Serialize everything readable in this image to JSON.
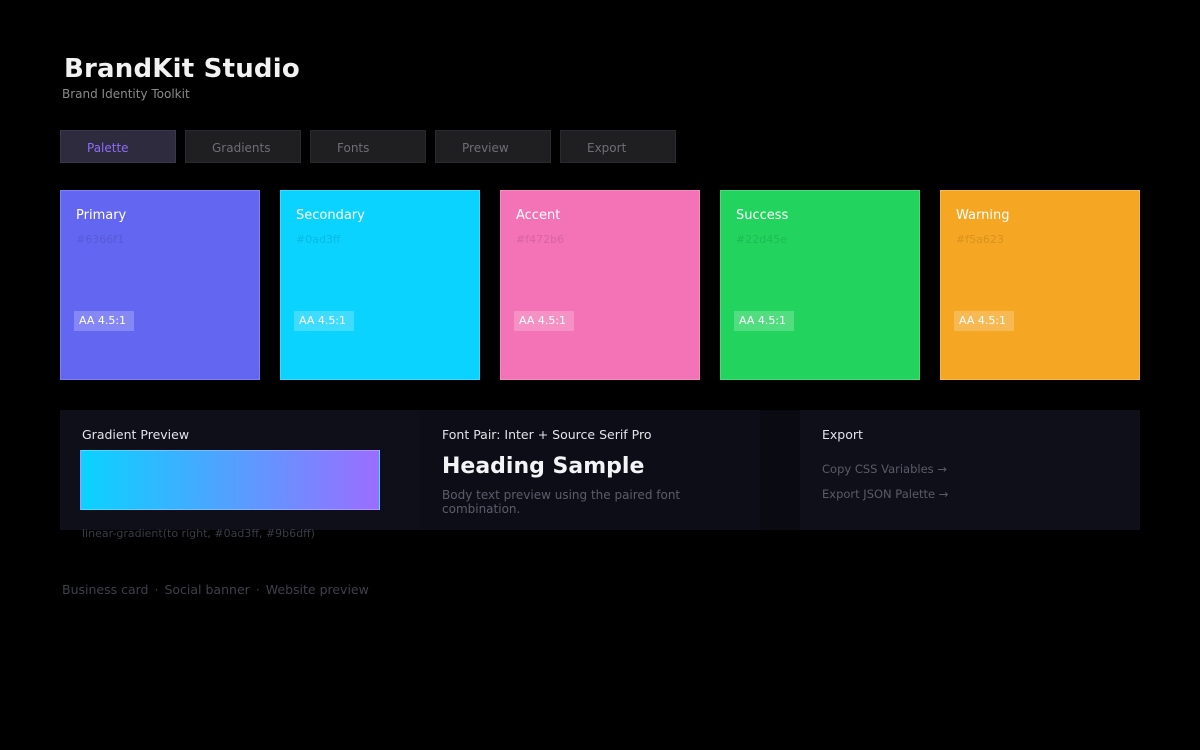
{
  "app": {
    "title": "BrandKit Studio",
    "subtitle": "Brand Identity Toolkit"
  },
  "tabs": [
    {
      "label": "Palette",
      "active": true
    },
    {
      "label": "Gradients",
      "active": false
    },
    {
      "label": "Fonts",
      "active": false
    },
    {
      "label": "Preview",
      "active": false
    },
    {
      "label": "Export",
      "active": false
    }
  ],
  "swatches": [
    {
      "name": "Primary",
      "hex": "#6366f1",
      "badge": "AA 4.5:1",
      "color": "#6366f1"
    },
    {
      "name": "Secondary",
      "hex": "#0ad3ff",
      "badge": "AA 4.5:1",
      "color": "#0ad3ff"
    },
    {
      "name": "Accent",
      "hex": "#f472b6",
      "badge": "AA 4.5:1",
      "color": "#f472b6"
    },
    {
      "name": "Success",
      "hex": "#22d45e",
      "badge": "AA 4.5:1",
      "color": "#22d45e"
    },
    {
      "name": "Warning",
      "hex": "#f5a623",
      "badge": "AA 4.5:1",
      "color": "#f5a623"
    }
  ],
  "gradient_panel": {
    "label": "Gradient Preview",
    "code": "linear-gradient(to right, #0ad3ff, #9b6dff)",
    "from": "#0ad3ff",
    "to": "#9b6dff"
  },
  "font_panel": {
    "label": "Font Pair: Inter + Source Serif Pro",
    "heading": "Heading Sample",
    "body": "Body text preview using the paired font combination."
  },
  "export_panel": {
    "label": "Export",
    "links": [
      {
        "label": "Copy CSS Variables",
        "arrow": "→"
      },
      {
        "label": "Export JSON Palette",
        "arrow": "→"
      }
    ]
  },
  "footer": {
    "items": [
      "Business card",
      "Social banner",
      "Website preview"
    ],
    "separator": "·"
  }
}
